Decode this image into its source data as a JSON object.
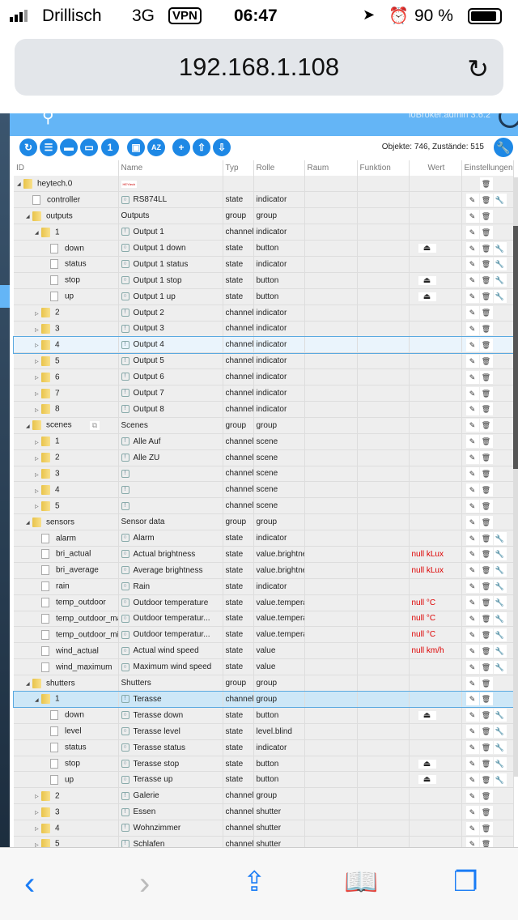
{
  "status": {
    "carrier": "Drillisch",
    "network": "3G",
    "vpn": "VPN",
    "time": "06:47",
    "battery": "90 %",
    "battery_level": 0.9
  },
  "browser": {
    "url": "192.168.1.108"
  },
  "app": {
    "version": "ioBroker.admin 3.6.2",
    "counts": "Objekte: 746, Zustände: 515"
  },
  "columns": [
    "ID",
    "Name",
    "Typ",
    "Rolle",
    "Raum",
    "Funktion",
    "Wert",
    "Einstellungen"
  ],
  "rows": [
    {
      "id": "heytech.0",
      "lvl": 0,
      "kind": "folder",
      "open": true,
      "logo": "HEYtech",
      "acts": "d"
    },
    {
      "id": "controller",
      "lvl": 1,
      "kind": "file",
      "name": "RS874LL",
      "ni": "state",
      "typ": "state",
      "rolle": "indicator",
      "acts": "edw"
    },
    {
      "id": "outputs",
      "lvl": 1,
      "kind": "folder",
      "open": true,
      "name": "Outputs",
      "typ": "group",
      "rolle": "group",
      "acts": "ed"
    },
    {
      "id": "1",
      "lvl": 2,
      "kind": "folder",
      "open": true,
      "name": "Output 1",
      "ni": "ch",
      "typ": "channel",
      "rolle": "indicator",
      "acts": "ed"
    },
    {
      "id": "down",
      "lvl": 3,
      "kind": "file",
      "name": "Output 1 down",
      "ni": "state",
      "typ": "state",
      "rolle": "button",
      "btn": true,
      "acts": "edw"
    },
    {
      "id": "status",
      "lvl": 3,
      "kind": "file",
      "name": "Output 1 status",
      "ni": "state",
      "typ": "state",
      "rolle": "indicator",
      "acts": "edw"
    },
    {
      "id": "stop",
      "lvl": 3,
      "kind": "file",
      "name": "Output 1 stop",
      "ni": "state",
      "typ": "state",
      "rolle": "button",
      "btn": true,
      "acts": "edw"
    },
    {
      "id": "up",
      "lvl": 3,
      "kind": "file",
      "name": "Output 1 up",
      "ni": "state",
      "typ": "state",
      "rolle": "button",
      "btn": true,
      "acts": "edw"
    },
    {
      "id": "2",
      "lvl": 2,
      "kind": "folder",
      "name": "Output 2",
      "ni": "ch",
      "typ": "channel",
      "rolle": "indicator",
      "acts": "ed"
    },
    {
      "id": "3",
      "lvl": 2,
      "kind": "folder",
      "name": "Output 3",
      "ni": "ch",
      "typ": "channel",
      "rolle": "indicator",
      "acts": "ed"
    },
    {
      "id": "4",
      "lvl": 2,
      "kind": "folder",
      "name": "Output 4",
      "ni": "ch",
      "typ": "channel",
      "rolle": "indicator",
      "acts": "ed",
      "hl": true
    },
    {
      "id": "5",
      "lvl": 2,
      "kind": "folder",
      "name": "Output 5",
      "ni": "ch",
      "typ": "channel",
      "rolle": "indicator",
      "acts": "ed"
    },
    {
      "id": "6",
      "lvl": 2,
      "kind": "folder",
      "name": "Output 6",
      "ni": "ch",
      "typ": "channel",
      "rolle": "indicator",
      "acts": "ed"
    },
    {
      "id": "7",
      "lvl": 2,
      "kind": "folder",
      "name": "Output 7",
      "ni": "ch",
      "typ": "channel",
      "rolle": "indicator",
      "acts": "ed"
    },
    {
      "id": "8",
      "lvl": 2,
      "kind": "folder",
      "name": "Output 8",
      "ni": "ch",
      "typ": "channel",
      "rolle": "indicator",
      "acts": "ed"
    },
    {
      "id": "scenes",
      "lvl": 1,
      "kind": "folder",
      "open": true,
      "copy": true,
      "name": "Scenes",
      "typ": "group",
      "rolle": "group",
      "acts": "ed"
    },
    {
      "id": "1",
      "lvl": 2,
      "kind": "folder",
      "name": "Alle Auf",
      "ni": "ch",
      "typ": "channel",
      "rolle": "scene",
      "acts": "ed"
    },
    {
      "id": "2",
      "lvl": 2,
      "kind": "folder",
      "name": "Alle ZU",
      "ni": "ch",
      "typ": "channel",
      "rolle": "scene",
      "acts": "ed"
    },
    {
      "id": "3",
      "lvl": 2,
      "kind": "folder",
      "name": "",
      "ni": "ch",
      "typ": "channel",
      "rolle": "scene",
      "acts": "ed"
    },
    {
      "id": "4",
      "lvl": 2,
      "kind": "folder",
      "name": "",
      "ni": "ch",
      "typ": "channel",
      "rolle": "scene",
      "acts": "ed"
    },
    {
      "id": "5",
      "lvl": 2,
      "kind": "folder",
      "name": "",
      "ni": "ch",
      "typ": "channel",
      "rolle": "scene",
      "acts": "ed"
    },
    {
      "id": "sensors",
      "lvl": 1,
      "kind": "folder",
      "open": true,
      "name": "Sensor data",
      "typ": "group",
      "rolle": "group",
      "acts": "ed"
    },
    {
      "id": "alarm",
      "lvl": 2,
      "kind": "file",
      "name": "Alarm",
      "ni": "state",
      "typ": "state",
      "rolle": "indicator",
      "acts": "edw"
    },
    {
      "id": "bri_actual",
      "lvl": 2,
      "kind": "file",
      "name": "Actual brightness",
      "ni": "state",
      "typ": "state",
      "rolle": "value.brightness",
      "wert": "null kLux",
      "acts": "edw"
    },
    {
      "id": "bri_average",
      "lvl": 2,
      "kind": "file",
      "name": "Average brightness",
      "ni": "state",
      "typ": "state",
      "rolle": "value.brightness",
      "wert": "null kLux",
      "acts": "edw"
    },
    {
      "id": "rain",
      "lvl": 2,
      "kind": "file",
      "name": "Rain",
      "ni": "state",
      "typ": "state",
      "rolle": "indicator",
      "acts": "edw"
    },
    {
      "id": "temp_outdoor",
      "lvl": 2,
      "kind": "file",
      "name": "Outdoor temperature",
      "ni": "state",
      "typ": "state",
      "rolle": "value.temperature",
      "wert": "null °C",
      "acts": "edw"
    },
    {
      "id": "temp_outdoor_max",
      "lvl": 2,
      "kind": "file",
      "name": "Outdoor temperatur...",
      "ni": "state",
      "typ": "state",
      "rolle": "value.temperature",
      "wert": "null °C",
      "acts": "edw"
    },
    {
      "id": "temp_outdoor_min",
      "lvl": 2,
      "kind": "file",
      "name": "Outdoor temperatur...",
      "ni": "state",
      "typ": "state",
      "rolle": "value.temperature",
      "wert": "null °C",
      "acts": "edw"
    },
    {
      "id": "wind_actual",
      "lvl": 2,
      "kind": "file",
      "name": "Actual wind speed",
      "ni": "state",
      "typ": "state",
      "rolle": "value",
      "wert": "null km/h",
      "acts": "edw"
    },
    {
      "id": "wind_maximum",
      "lvl": 2,
      "kind": "file",
      "name": "Maximum wind speed",
      "ni": "state",
      "typ": "state",
      "rolle": "value",
      "acts": "edw"
    },
    {
      "id": "shutters",
      "lvl": 1,
      "kind": "folder",
      "open": true,
      "name": "Shutters",
      "typ": "group",
      "rolle": "group",
      "acts": "ed"
    },
    {
      "id": "1",
      "lvl": 2,
      "kind": "folder",
      "open": true,
      "name": "Terasse",
      "ni": "ch",
      "typ": "channel",
      "rolle": "group",
      "acts": "ed",
      "sel": true
    },
    {
      "id": "down",
      "lvl": 3,
      "kind": "file",
      "name": "Terasse down",
      "ni": "state",
      "typ": "state",
      "rolle": "button",
      "btn": true,
      "acts": "edw"
    },
    {
      "id": "level",
      "lvl": 3,
      "kind": "file",
      "name": "Terasse level",
      "ni": "state",
      "typ": "state",
      "rolle": "level.blind",
      "acts": "edw"
    },
    {
      "id": "status",
      "lvl": 3,
      "kind": "file",
      "name": "Terasse status",
      "ni": "state",
      "typ": "state",
      "rolle": "indicator",
      "acts": "edw"
    },
    {
      "id": "stop",
      "lvl": 3,
      "kind": "file",
      "name": "Terasse stop",
      "ni": "state",
      "typ": "state",
      "rolle": "button",
      "btn": true,
      "acts": "edw"
    },
    {
      "id": "up",
      "lvl": 3,
      "kind": "file",
      "name": "Terasse up",
      "ni": "state",
      "typ": "state",
      "rolle": "button",
      "btn": true,
      "acts": "edw"
    },
    {
      "id": "2",
      "lvl": 2,
      "kind": "folder",
      "name": "Galerie",
      "ni": "ch",
      "typ": "channel",
      "rolle": "group",
      "acts": "ed"
    },
    {
      "id": "3",
      "lvl": 2,
      "kind": "folder",
      "name": "Essen",
      "ni": "ch",
      "typ": "channel",
      "rolle": "shutter",
      "acts": "ed"
    },
    {
      "id": "4",
      "lvl": 2,
      "kind": "folder",
      "name": "Wohnzimmer",
      "ni": "ch",
      "typ": "channel",
      "rolle": "shutter",
      "acts": "ed"
    },
    {
      "id": "5",
      "lvl": 2,
      "kind": "folder",
      "name": "Schlafen",
      "ni": "ch",
      "typ": "channel",
      "rolle": "shutter",
      "acts": "ed"
    }
  ]
}
